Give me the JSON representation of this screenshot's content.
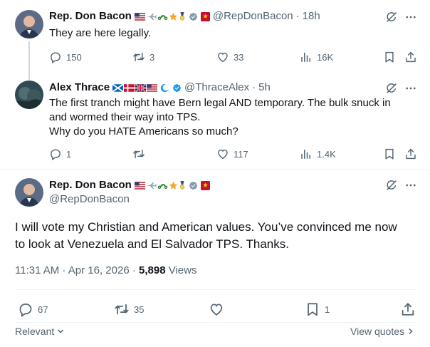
{
  "reply1": {
    "author_name": "Rep. Don Bacon",
    "handle": "@RepDonBacon",
    "separator": "·",
    "time": "18h",
    "text": "They are here legally.",
    "replies": "150",
    "reposts": "3",
    "likes": "33",
    "views": "16K"
  },
  "reply2": {
    "author_name": "Alex Thrace",
    "handle": "@ThraceAlex",
    "separator": "·",
    "time": "5h",
    "text_lines": [
      "The first tranch might have Bern legal AND temporary. The bulk snuck in",
      "and wormed their way into TPS.",
      "Why do you HATE Americans so much?"
    ],
    "replies": "1",
    "reposts": "",
    "likes": "117",
    "views": "1.4K"
  },
  "main": {
    "author_name": "Rep. Don Bacon",
    "handle": "@RepDonBacon",
    "text_lines": [
      "I will vote my Christian and American values. You’ve convinced me now",
      "to look at Venezuela and El Salvador TPS. Thanks."
    ],
    "timestamp": "11:31 AM · Apr 16, 2026 ·",
    "views_count": "5,898",
    "views_label": "Views",
    "replies": "67",
    "reposts": "35",
    "likes": "",
    "bookmarks": "1"
  },
  "footer": {
    "relevant_label": "Relevant",
    "view_quotes_label": "View quotes"
  },
  "colors": {
    "text": "#0f1419",
    "secondary": "#536471",
    "verified_gray": "#829aab",
    "verified_blue": "#1d9bf0",
    "divider": "#eff3f4"
  }
}
